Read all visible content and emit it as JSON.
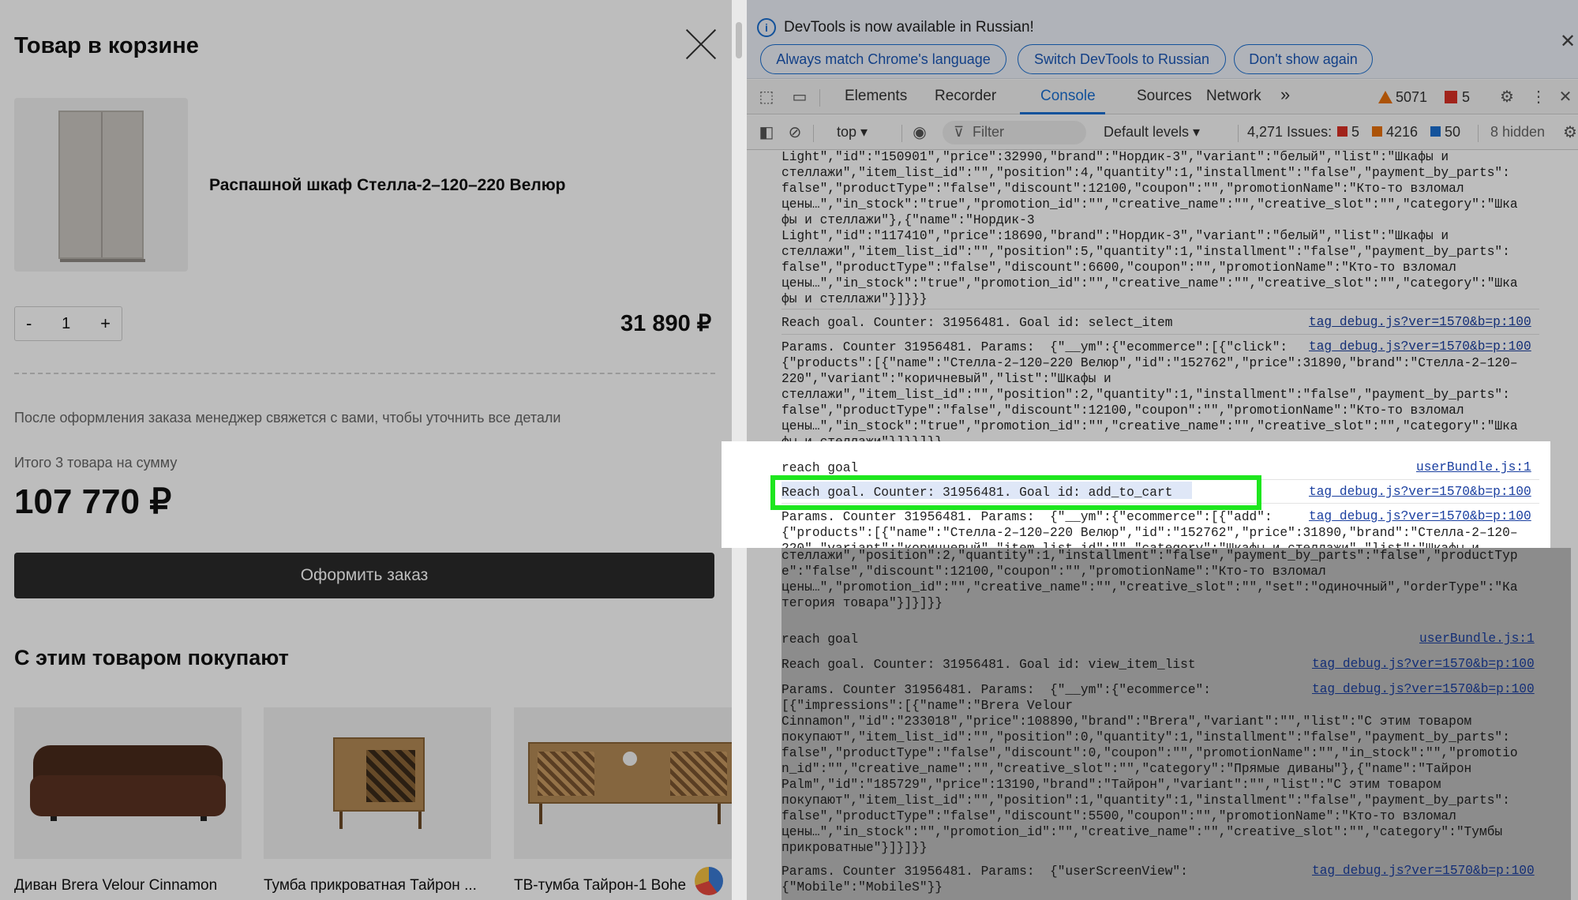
{
  "cart": {
    "title": "Товар в корзине",
    "product_name": "Распашной шкаф Стелла-2–120–220 Велюр",
    "qty_minus": "-",
    "qty_value": "1",
    "qty_plus": "+",
    "price": "31 890 ₽",
    "note": "После оформления заказа менеджер свяжется с вами, чтобы уточнить все детали",
    "total_label": "Итого 3 товара на сумму",
    "total": "107 770 ₽",
    "order_button": "Оформить заказ",
    "also_title": "С этим товаром покупают",
    "recommendations": [
      {
        "title": "Диван Brera Velour Cinnamon"
      },
      {
        "title": "Тумба прикроватная Тайрон ..."
      },
      {
        "title": "ТВ-тумба Тайрон-1 Bohe"
      }
    ]
  },
  "devtools": {
    "infobar": {
      "message": "DevTools is now available in Russian!",
      "btn_match": "Always match Chrome's language",
      "btn_switch": "Switch DevTools to Russian",
      "btn_dont": "Don't show again"
    },
    "tabs": [
      "Elements",
      "Recorder",
      "Console",
      "Sources",
      "Network"
    ],
    "active_tab": "Console",
    "more_tabs": "»",
    "warning_count": "5071",
    "error_count": "5",
    "toolbar": {
      "context": "top ▾",
      "filter_placeholder": "Filter",
      "levels": "Default levels ▾",
      "issues_label": "4,271 Issues:",
      "issues_errors": "5",
      "issues_warnings": "4216",
      "issues_info": "50",
      "hidden": "8 hidden"
    },
    "log_entries": [
      {
        "text": "Light\",\"id\":\"150901\",\"price\":32990,\"brand\":\"Нордик-3\",\"variant\":\"белый\",\"list\":\"Шкафы и\nстеллажи\",\"item_list_id\":\"\",\"position\":4,\"quantity\":1,\"installment\":\"false\",\"payment_by_parts\":\nfalse\",\"productType\":\"false\",\"discount\":12100,\"coupon\":\"\",\"promotionName\":\"Кто-то взломал\nцены…\",\"in_stock\":\"true\",\"promotion_id\":\"\",\"creative_name\":\"\",\"creative_slot\":\"\",\"category\":\"Шка\nфы и стеллажи\"},{\"name\":\"Нордик-3\nLight\",\"id\":\"117410\",\"price\":18690,\"brand\":\"Нордик-3\",\"variant\":\"белый\",\"list\":\"Шкафы и\nстеллажи\",\"item_list_id\":\"\",\"position\":5,\"quantity\":1,\"installment\":\"false\",\"payment_by_parts\":\nfalse\",\"productType\":\"false\",\"discount\":6600,\"coupon\":\"\",\"promotionName\":\"Кто-то взломал\nцены…\",\"in_stock\":\"true\",\"promotion_id\":\"\",\"creative_name\":\"\",\"creative_slot\":\"\",\"category\":\"Шка\nфы и стеллажи\"}]}}}",
        "source": ""
      },
      {
        "text": "Reach goal. Counter: 31956481. Goal id: select_item",
        "source": "tag_debug.js?ver=1570&b=p:100"
      },
      {
        "text": "Params. Counter 31956481. Params:  {\"__ym\":{\"ecommerce\":[{\"click\":\n{\"products\":[{\"name\":\"Стелла-2–120–220 Велюр\",\"id\":\"152762\",\"price\":31890,\"brand\":\"Стелла-2–120–\n220\",\"variant\":\"коричневый\",\"list\":\"Шкафы и\nстеллажи\",\"item_list_id\":\"\",\"position\":2,\"quantity\":1,\"installment\":\"false\",\"payment_by_parts\":\nfalse\",\"productType\":\"false\",\"discount\":12100,\"coupon\":\"\",\"promotionName\":\"Кто-то взломал\nцены…\",\"in_stock\":\"true\",\"promotion_id\":\"\",\"creative_name\":\"\",\"creative_slot\":\"\",\"category\":\"Шка\nфы и стеллажи\"}]}}]}}",
        "source": "tag_debug.js?ver=1570&b=p:100"
      },
      {
        "text": "reach goal",
        "source": "userBundle.js:1"
      },
      {
        "text": "Reach goal. Counter: 31956481. Goal id: add_to_cart",
        "source": "tag_debug.js?ver=1570&b=p:100"
      },
      {
        "text": "Params. Counter 31956481. Params:  {\"__ym\":{\"ecommerce\":[{\"add\":\n{\"products\":[{\"name\":\"Стелла-2–120–220 Велюр\",\"id\":\"152762\",\"price\":31890,\"brand\":\"Стелла-2–120–\n220\",\"variant\":\"коричневый\",\"item_list_id\":\"\",\"category\":\"Шкафы и стеллажи\",\"list\":\"Шкафы и\nстеллажи\",\"position\":2,\"quantity\":1,\"installment\":\"false\",\"payment_by_parts\":\"false\",\"productTyp\ne\":\"false\",\"discount\":12100,\"coupon\":\"\",\"promotionName\":\"Кто-то взломал\nцены…\",\"promotion_id\":\"\",\"creative_name\":\"\",\"creative_slot\":\"\",\"set\":\"одиночный\",\"orderType\":\"Ка\nтегория товара\"}]}]}}",
        "source": "tag_debug.js?ver=1570&b=p:100"
      },
      {
        "text": "reach goal",
        "source": "userBundle.js:1"
      },
      {
        "text": "Reach goal. Counter: 31956481. Goal id: view_item_list",
        "source": "tag_debug.js?ver=1570&b=p:100"
      },
      {
        "text": "Params. Counter 31956481. Params:  {\"__ym\":{\"ecommerce\":\n[{\"impressions\":[{\"name\":\"Brera Velour\nCinnamon\",\"id\":\"233018\",\"price\":108890,\"brand\":\"Brera\",\"variant\":\"\",\"list\":\"С этим товаром\nпокупают\",\"item_list_id\":\"\",\"position\":0,\"quantity\":1,\"installment\":\"false\",\"payment_by_parts\":\nfalse\",\"productType\":\"false\",\"discount\":0,\"coupon\":\"\",\"promotionName\":\"\",\"in_stock\":\"\",\"promotio\nn_id\":\"\",\"creative_name\":\"\",\"creative_slot\":\"\",\"category\":\"Прямые диваны\"},{\"name\":\"Тайрон\nPalm\",\"id\":\"185729\",\"price\":13190,\"brand\":\"Тайрон\",\"variant\":\"\",\"list\":\"С этим товаром\nпокупают\",\"item_list_id\":\"\",\"position\":1,\"quantity\":1,\"installment\":\"false\",\"payment_by_parts\":\nfalse\",\"productType\":\"false\",\"discount\":5500,\"coupon\":\"\",\"promotionName\":\"Кто-то взломал\nцены…\",\"in_stock\":\"\",\"promotion_id\":\"\",\"creative_name\":\"\",\"creative_slot\":\"\",\"category\":\"Тумбы\nприкроватные\"}]}]}}",
        "source": "tag_debug.js?ver=1570&b=p:100"
      },
      {
        "text": "Params. Counter 31956481. Params:  {\"userScreenView\":\n{\"Mobile\":\"MobileS\"}}",
        "source": "tag_debug.js?ver=1570&b=p:100"
      }
    ]
  }
}
